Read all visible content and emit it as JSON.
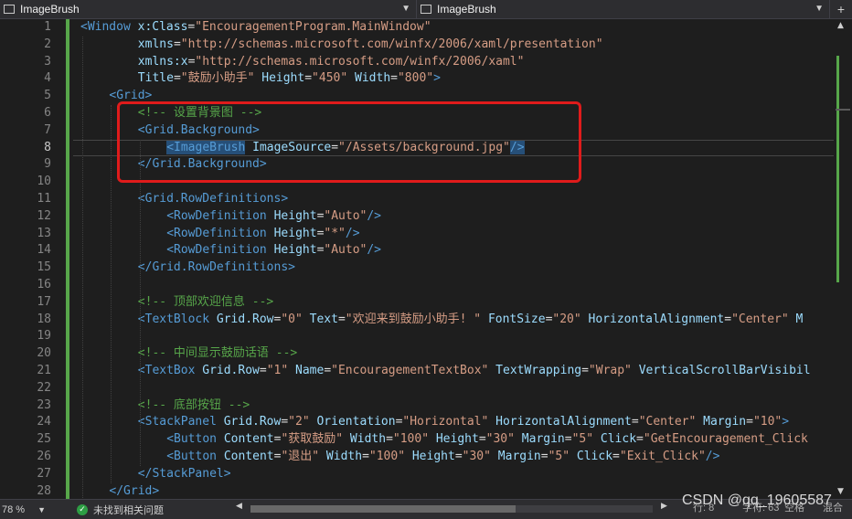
{
  "top_bar": {
    "left_combo": "ImageBrush",
    "right_combo": "ImageBrush",
    "split_button": "+"
  },
  "editor": {
    "current_line": 8,
    "lines": [
      {
        "num": "1",
        "indent": 0,
        "tokens": [
          {
            "t": "tag",
            "v": "<Window "
          },
          {
            "t": "attr",
            "v": "x:Class"
          },
          {
            "t": "plain",
            "v": "="
          },
          {
            "t": "val",
            "v": "\"EncouragementProgram.MainWindow\""
          }
        ]
      },
      {
        "num": "2",
        "indent": 8,
        "tokens": [
          {
            "t": "attr",
            "v": "xmlns"
          },
          {
            "t": "plain",
            "v": "="
          },
          {
            "t": "val",
            "v": "\"http://schemas.microsoft.com/winfx/2006/xaml/presentation\""
          }
        ]
      },
      {
        "num": "3",
        "indent": 8,
        "tokens": [
          {
            "t": "attr",
            "v": "xmlns:x"
          },
          {
            "t": "plain",
            "v": "="
          },
          {
            "t": "val",
            "v": "\"http://schemas.microsoft.com/winfx/2006/xaml\""
          }
        ]
      },
      {
        "num": "4",
        "indent": 8,
        "tokens": [
          {
            "t": "attr",
            "v": "Title"
          },
          {
            "t": "plain",
            "v": "="
          },
          {
            "t": "val",
            "v": "\"鼓励小助手\""
          },
          {
            "t": "plain",
            "v": " "
          },
          {
            "t": "attr",
            "v": "Height"
          },
          {
            "t": "plain",
            "v": "="
          },
          {
            "t": "val",
            "v": "\"450\""
          },
          {
            "t": "plain",
            "v": " "
          },
          {
            "t": "attr",
            "v": "Width"
          },
          {
            "t": "plain",
            "v": "="
          },
          {
            "t": "val",
            "v": "\"800\""
          },
          {
            "t": "tag",
            "v": ">"
          }
        ]
      },
      {
        "num": "5",
        "indent": 4,
        "tokens": [
          {
            "t": "tag",
            "v": "<Grid>"
          }
        ]
      },
      {
        "num": "6",
        "indent": 8,
        "tokens": [
          {
            "t": "cmt",
            "v": "<!-- 设置背景图 -->"
          }
        ]
      },
      {
        "num": "7",
        "indent": 8,
        "tokens": [
          {
            "t": "tag",
            "v": "<Grid.Background>"
          }
        ]
      },
      {
        "num": "8",
        "indent": 12,
        "tokens": [
          {
            "t": "tag",
            "v": "<",
            "hl": true
          },
          {
            "t": "tag",
            "v": "ImageBrush",
            "hl": true
          },
          {
            "t": "plain",
            "v": " "
          },
          {
            "t": "attr",
            "v": "ImageSource"
          },
          {
            "t": "plain",
            "v": "="
          },
          {
            "t": "val",
            "v": "\"/Assets/background.jpg\""
          },
          {
            "t": "tag",
            "v": "/>",
            "hl": true
          }
        ]
      },
      {
        "num": "9",
        "indent": 8,
        "tokens": [
          {
            "t": "tag",
            "v": "</Grid.Background>"
          }
        ]
      },
      {
        "num": "10",
        "indent": 0,
        "tokens": []
      },
      {
        "num": "11",
        "indent": 8,
        "tokens": [
          {
            "t": "tag",
            "v": "<Grid.RowDefinitions>"
          }
        ]
      },
      {
        "num": "12",
        "indent": 12,
        "tokens": [
          {
            "t": "tag",
            "v": "<RowDefinition "
          },
          {
            "t": "attr",
            "v": "Height"
          },
          {
            "t": "plain",
            "v": "="
          },
          {
            "t": "val",
            "v": "\"Auto\""
          },
          {
            "t": "tag",
            "v": "/>"
          }
        ]
      },
      {
        "num": "13",
        "indent": 12,
        "tokens": [
          {
            "t": "tag",
            "v": "<RowDefinition "
          },
          {
            "t": "attr",
            "v": "Height"
          },
          {
            "t": "plain",
            "v": "="
          },
          {
            "t": "val",
            "v": "\"*\""
          },
          {
            "t": "tag",
            "v": "/>"
          }
        ]
      },
      {
        "num": "14",
        "indent": 12,
        "tokens": [
          {
            "t": "tag",
            "v": "<RowDefinition "
          },
          {
            "t": "attr",
            "v": "Height"
          },
          {
            "t": "plain",
            "v": "="
          },
          {
            "t": "val",
            "v": "\"Auto\""
          },
          {
            "t": "tag",
            "v": "/>"
          }
        ]
      },
      {
        "num": "15",
        "indent": 8,
        "tokens": [
          {
            "t": "tag",
            "v": "</Grid.RowDefinitions>"
          }
        ]
      },
      {
        "num": "16",
        "indent": 0,
        "tokens": []
      },
      {
        "num": "17",
        "indent": 8,
        "tokens": [
          {
            "t": "cmt",
            "v": "<!-- 顶部欢迎信息 -->"
          }
        ]
      },
      {
        "num": "18",
        "indent": 8,
        "tokens": [
          {
            "t": "tag",
            "v": "<TextBlock "
          },
          {
            "t": "attr",
            "v": "Grid.Row"
          },
          {
            "t": "plain",
            "v": "="
          },
          {
            "t": "val",
            "v": "\"0\""
          },
          {
            "t": "plain",
            "v": " "
          },
          {
            "t": "attr",
            "v": "Text"
          },
          {
            "t": "plain",
            "v": "="
          },
          {
            "t": "val",
            "v": "\"欢迎来到鼓励小助手! \""
          },
          {
            "t": "plain",
            "v": " "
          },
          {
            "t": "attr",
            "v": "FontSize"
          },
          {
            "t": "plain",
            "v": "="
          },
          {
            "t": "val",
            "v": "\"20\""
          },
          {
            "t": "plain",
            "v": " "
          },
          {
            "t": "attr",
            "v": "HorizontalAlignment"
          },
          {
            "t": "plain",
            "v": "="
          },
          {
            "t": "val",
            "v": "\"Center\""
          },
          {
            "t": "plain",
            "v": " "
          },
          {
            "t": "attr",
            "v": "M"
          }
        ]
      },
      {
        "num": "19",
        "indent": 0,
        "tokens": []
      },
      {
        "num": "20",
        "indent": 8,
        "tokens": [
          {
            "t": "cmt",
            "v": "<!-- 中间显示鼓励话语 -->"
          }
        ]
      },
      {
        "num": "21",
        "indent": 8,
        "tokens": [
          {
            "t": "tag",
            "v": "<TextBox "
          },
          {
            "t": "attr",
            "v": "Grid.Row"
          },
          {
            "t": "plain",
            "v": "="
          },
          {
            "t": "val",
            "v": "\"1\""
          },
          {
            "t": "plain",
            "v": " "
          },
          {
            "t": "attr",
            "v": "Name"
          },
          {
            "t": "plain",
            "v": "="
          },
          {
            "t": "val",
            "v": "\"EncouragementTextBox\""
          },
          {
            "t": "plain",
            "v": " "
          },
          {
            "t": "attr",
            "v": "TextWrapping"
          },
          {
            "t": "plain",
            "v": "="
          },
          {
            "t": "val",
            "v": "\"Wrap\""
          },
          {
            "t": "plain",
            "v": " "
          },
          {
            "t": "attr",
            "v": "VerticalScrollBarVisibil"
          }
        ]
      },
      {
        "num": "22",
        "indent": 0,
        "tokens": []
      },
      {
        "num": "23",
        "indent": 8,
        "tokens": [
          {
            "t": "cmt",
            "v": "<!-- 底部按钮 -->"
          }
        ]
      },
      {
        "num": "24",
        "indent": 8,
        "tokens": [
          {
            "t": "tag",
            "v": "<StackPanel "
          },
          {
            "t": "attr",
            "v": "Grid.Row"
          },
          {
            "t": "plain",
            "v": "="
          },
          {
            "t": "val",
            "v": "\"2\""
          },
          {
            "t": "plain",
            "v": " "
          },
          {
            "t": "attr",
            "v": "Orientation"
          },
          {
            "t": "plain",
            "v": "="
          },
          {
            "t": "val",
            "v": "\"Horizontal\""
          },
          {
            "t": "plain",
            "v": " "
          },
          {
            "t": "attr",
            "v": "HorizontalAlignment"
          },
          {
            "t": "plain",
            "v": "="
          },
          {
            "t": "val",
            "v": "\"Center\""
          },
          {
            "t": "plain",
            "v": " "
          },
          {
            "t": "attr",
            "v": "Margin"
          },
          {
            "t": "plain",
            "v": "="
          },
          {
            "t": "val",
            "v": "\"10\""
          },
          {
            "t": "tag",
            "v": ">"
          }
        ]
      },
      {
        "num": "25",
        "indent": 12,
        "tokens": [
          {
            "t": "tag",
            "v": "<Button "
          },
          {
            "t": "attr",
            "v": "Content"
          },
          {
            "t": "plain",
            "v": "="
          },
          {
            "t": "val",
            "v": "\"获取鼓励\""
          },
          {
            "t": "plain",
            "v": " "
          },
          {
            "t": "attr",
            "v": "Width"
          },
          {
            "t": "plain",
            "v": "="
          },
          {
            "t": "val",
            "v": "\"100\""
          },
          {
            "t": "plain",
            "v": " "
          },
          {
            "t": "attr",
            "v": "Height"
          },
          {
            "t": "plain",
            "v": "="
          },
          {
            "t": "val",
            "v": "\"30\""
          },
          {
            "t": "plain",
            "v": " "
          },
          {
            "t": "attr",
            "v": "Margin"
          },
          {
            "t": "plain",
            "v": "="
          },
          {
            "t": "val",
            "v": "\"5\""
          },
          {
            "t": "plain",
            "v": " "
          },
          {
            "t": "attr",
            "v": "Click"
          },
          {
            "t": "plain",
            "v": "="
          },
          {
            "t": "val",
            "v": "\"GetEncouragement_Click"
          }
        ]
      },
      {
        "num": "26",
        "indent": 12,
        "tokens": [
          {
            "t": "tag",
            "v": "<Button "
          },
          {
            "t": "attr",
            "v": "Content"
          },
          {
            "t": "plain",
            "v": "="
          },
          {
            "t": "val",
            "v": "\"退出\""
          },
          {
            "t": "plain",
            "v": " "
          },
          {
            "t": "attr",
            "v": "Width"
          },
          {
            "t": "plain",
            "v": "="
          },
          {
            "t": "val",
            "v": "\"100\""
          },
          {
            "t": "plain",
            "v": " "
          },
          {
            "t": "attr",
            "v": "Height"
          },
          {
            "t": "plain",
            "v": "="
          },
          {
            "t": "val",
            "v": "\"30\""
          },
          {
            "t": "plain",
            "v": " "
          },
          {
            "t": "attr",
            "v": "Margin"
          },
          {
            "t": "plain",
            "v": "="
          },
          {
            "t": "val",
            "v": "\"5\""
          },
          {
            "t": "plain",
            "v": " "
          },
          {
            "t": "attr",
            "v": "Click"
          },
          {
            "t": "plain",
            "v": "="
          },
          {
            "t": "val",
            "v": "\"Exit_Click\""
          },
          {
            "t": "tag",
            "v": "/>"
          }
        ]
      },
      {
        "num": "27",
        "indent": 8,
        "tokens": [
          {
            "t": "tag",
            "v": "</StackPanel>"
          }
        ]
      },
      {
        "num": "28",
        "indent": 4,
        "tokens": [
          {
            "t": "tag",
            "v": "</Grid>"
          }
        ]
      }
    ]
  },
  "status_bar": {
    "zoom": "78 %",
    "issues": "未找到相关问题",
    "line": "行: 8",
    "char": "字符: 63",
    "spaces": "空格",
    "encoding": "混合"
  },
  "watermark": "CSDN @qq_19605587",
  "colors": {
    "tag": "#569cd6",
    "attribute": "#9cdcfe",
    "value": "#d69d85",
    "comment": "#57a64a",
    "highlight_box": "#e01b1b"
  }
}
